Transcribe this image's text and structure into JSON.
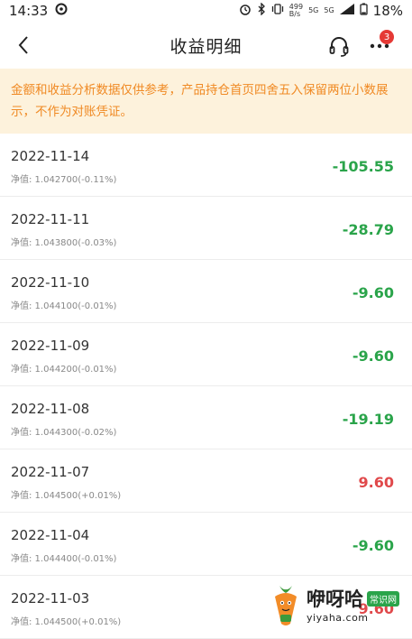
{
  "status_bar": {
    "time": "14:33",
    "battery": "18%",
    "speed": "499\nB/s",
    "signal1": "5G",
    "signal2": "5G"
  },
  "nav": {
    "title": "收益明细",
    "badge_count": "3"
  },
  "notice": "金额和收益分析数据仅供参考，产品持仓首页四舍五入保留两位小数展示，不作为对账凭证。",
  "records": [
    {
      "date": "2022-11-14",
      "nav": "净值: 1.042700(-0.11%)",
      "amount": "-105.55",
      "sign": "neg"
    },
    {
      "date": "2022-11-11",
      "nav": "净值: 1.043800(-0.03%)",
      "amount": "-28.79",
      "sign": "neg"
    },
    {
      "date": "2022-11-10",
      "nav": "净值: 1.044100(-0.01%)",
      "amount": "-9.60",
      "sign": "neg"
    },
    {
      "date": "2022-11-09",
      "nav": "净值: 1.044200(-0.01%)",
      "amount": "-9.60",
      "sign": "neg"
    },
    {
      "date": "2022-11-08",
      "nav": "净值: 1.044300(-0.02%)",
      "amount": "-19.19",
      "sign": "neg"
    },
    {
      "date": "2022-11-07",
      "nav": "净值: 1.044500(+0.01%)",
      "amount": "9.60",
      "sign": "pos"
    },
    {
      "date": "2022-11-04",
      "nav": "净值: 1.044400(-0.01%)",
      "amount": "-9.60",
      "sign": "neg"
    },
    {
      "date": "2022-11-03",
      "nav": "净值: 1.044500(+0.01%)",
      "amount": "9.60",
      "sign": "pos"
    }
  ],
  "watermark": {
    "name": "咿呀哈",
    "tag": "常识网",
    "url": "yiyaha.com"
  },
  "colors": {
    "negative": "#2aa44a",
    "positive": "#e0494b",
    "notice_bg": "#fdf2dc",
    "notice_text": "#f08a24",
    "badge": "#e53935"
  }
}
